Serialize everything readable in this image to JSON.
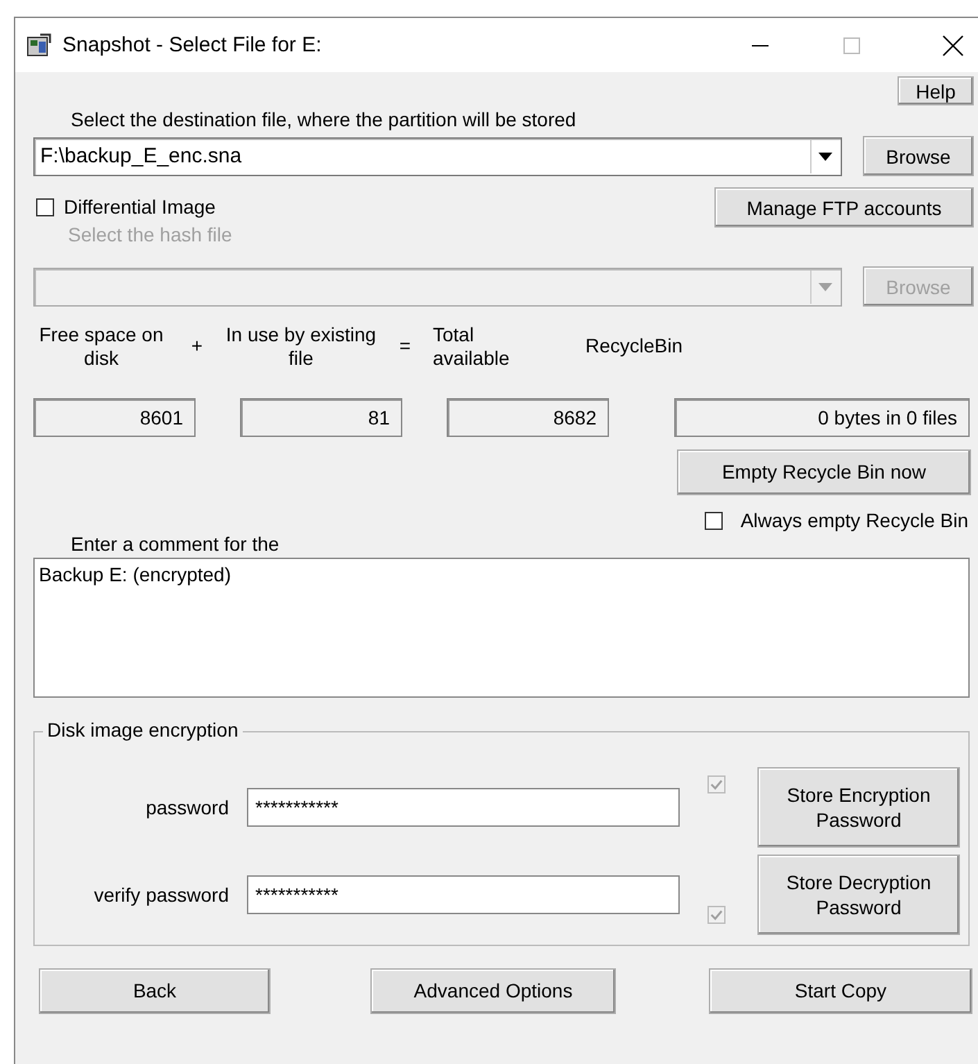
{
  "window": {
    "title": "Snapshot - Select File for E:"
  },
  "help_button": "Help",
  "destination": {
    "label": "Select the destination file, where the partition will be stored",
    "value": "F:\\backup_E_enc.sna",
    "browse": "Browse"
  },
  "differential": {
    "label": "Differential Image",
    "checked": false
  },
  "manage_ftp": "Manage FTP accounts",
  "hash_file": {
    "label": "Select the hash file",
    "disabled": true,
    "browse": "Browse"
  },
  "space": [
    {
      "label": "Free space on disk",
      "operator": "+",
      "value": "8601"
    },
    {
      "label": "In use by existing file",
      "operator": "=",
      "value": "81"
    },
    {
      "label": "Total available",
      "value": "8682"
    }
  ],
  "recycle_bin": {
    "label": "RecycleBin",
    "value": "0 bytes in 0 files",
    "empty_button": "Empty Recycle Bin now",
    "always_empty": {
      "label": "Always empty Recycle Bin",
      "checked": false
    }
  },
  "comment": {
    "label": "Enter a comment for the",
    "value": "Backup E: (encrypted)"
  },
  "encryption": {
    "title": "Disk image encryption",
    "fields": [
      {
        "label": "password",
        "value": "***********",
        "store_checked": true,
        "store_disabled": true,
        "store_button": "Store Encryption Password"
      },
      {
        "label": "verify password",
        "value": "***********",
        "store_checked": true,
        "store_disabled": true,
        "store_button": "Store Decryption Password"
      }
    ]
  },
  "buttons": [
    "Back",
    "Advanced Options",
    "Start Copy"
  ]
}
